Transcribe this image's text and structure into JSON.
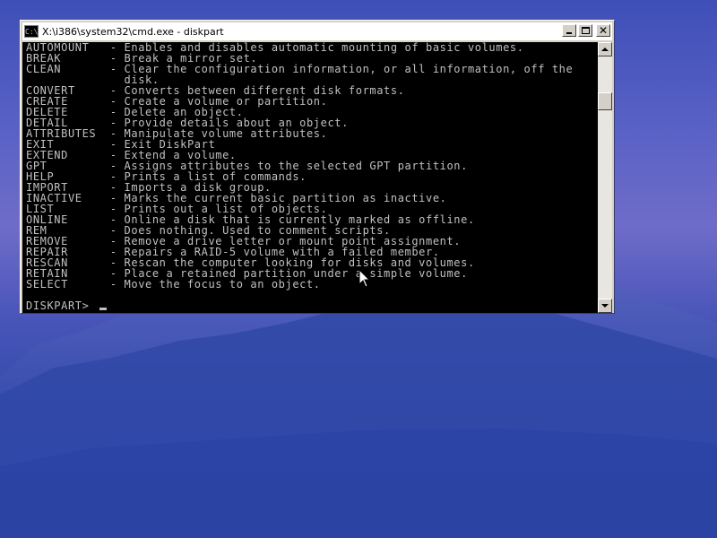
{
  "window": {
    "title": "X:\\i386\\system32\\cmd.exe - diskpart",
    "icon_text": "C:\\"
  },
  "console": {
    "lines": [
      "AUTOMOUNT   - Enables and disables automatic mounting of basic volumes.",
      "BREAK       - Break a mirror set.",
      "CLEAN       - Clear the configuration information, or all information, off the",
      "              disk.",
      "CONVERT     - Converts between different disk formats.",
      "CREATE      - Create a volume or partition.",
      "DELETE      - Delete an object.",
      "DETAIL      - Provide details about an object.",
      "ATTRIBUTES  - Manipulate volume attributes.",
      "EXIT        - Exit DiskPart",
      "EXTEND      - Extend a volume.",
      "GPT         - Assigns attributes to the selected GPT partition.",
      "HELP        - Prints a list of commands.",
      "IMPORT      - Imports a disk group.",
      "INACTIVE    - Marks the current basic partition as inactive.",
      "LIST        - Prints out a list of objects.",
      "ONLINE      - Online a disk that is currently marked as offline.",
      "REM         - Does nothing. Used to comment scripts.",
      "REMOVE      - Remove a drive letter or mount point assignment.",
      "REPAIR      - Repairs a RAID-5 volume with a failed member.",
      "RESCAN      - Rescan the computer looking for disks and volumes.",
      "RETAIN      - Place a retained partition under a simple volume.",
      "SELECT      - Move the focus to an object."
    ],
    "prompt": "DISKPART>"
  }
}
